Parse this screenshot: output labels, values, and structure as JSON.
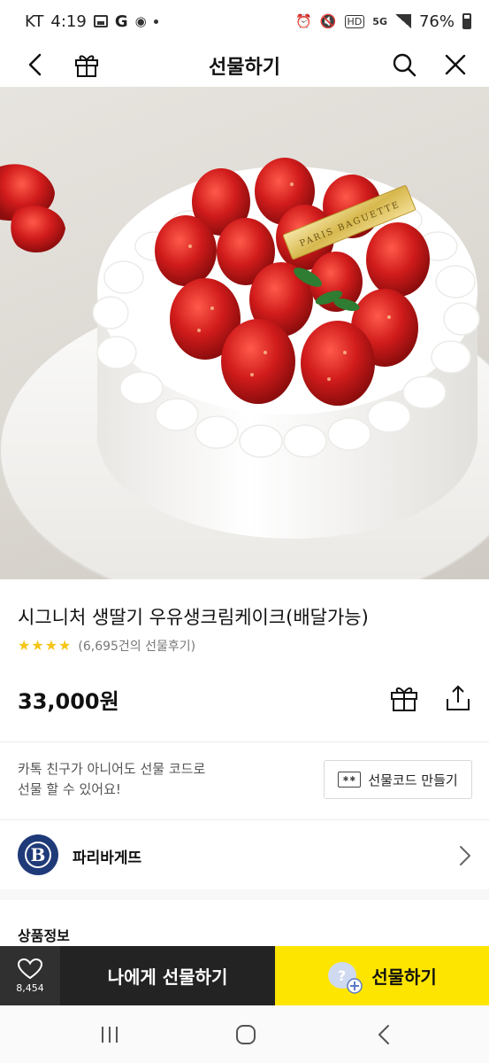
{
  "status_bar": {
    "carrier": "KT",
    "time": "4:19",
    "battery": "76%",
    "network": "5G"
  },
  "header": {
    "title": "선물하기"
  },
  "hero": {
    "plaque_text": "PARIS BAGUETTE"
  },
  "product": {
    "title": "시그니처 생딸기 우유생크림케이크(배달가능)",
    "rating_stars": 4,
    "review_count": "(6,695건의 선물후기)",
    "price": "33,000원"
  },
  "gift_code": {
    "description": "카톡 친구가 아니어도 선물 코드로\n선물 할 수 있어요!",
    "button_label": "선물코드 만들기"
  },
  "brand": {
    "name": "파리바게뜨",
    "logo_letter": "B"
  },
  "section": {
    "title": "상품정보"
  },
  "action_bar": {
    "like_count": "8,454",
    "self_gift_label": "나에게 선물하기",
    "gift_label": "선물하기"
  },
  "colors": {
    "accent_yellow": "#fee500",
    "dark_button": "#232323",
    "star": "#f5c518",
    "brand_navy": "#1f3a78"
  }
}
